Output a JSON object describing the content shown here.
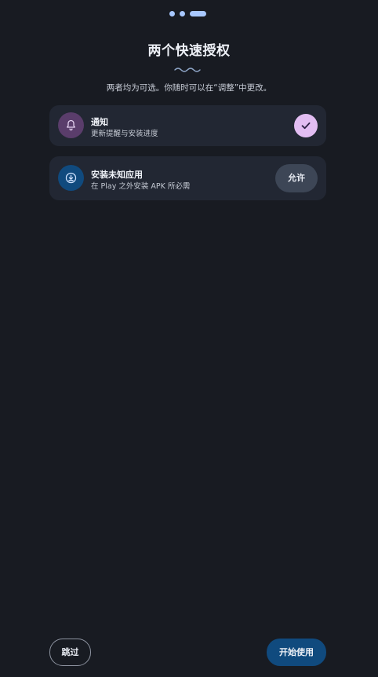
{
  "pager": {
    "current": 3,
    "total": 3
  },
  "header": {
    "title": "两个快速授权",
    "subtitle": "两者均为可选。你随时可以在“调整”中更改。"
  },
  "permissions": [
    {
      "title": "通知",
      "description": "更新提醒与安装进度",
      "icon": "bell-icon",
      "granted": true,
      "accent": "#5a3d6b"
    },
    {
      "title": "安装未知应用",
      "description": "在 Play 之外安装 APK 所必需",
      "icon": "download-icon",
      "granted": false,
      "action_label": "允许",
      "accent": "#104a7e"
    }
  ],
  "footer": {
    "skip_label": "跳过",
    "start_label": "开始使用"
  },
  "colors": {
    "background": "#181b22",
    "card": "#222733",
    "primary": "#104a7e",
    "check": "#e2bdf2",
    "indicator": "#a8c8ff"
  }
}
